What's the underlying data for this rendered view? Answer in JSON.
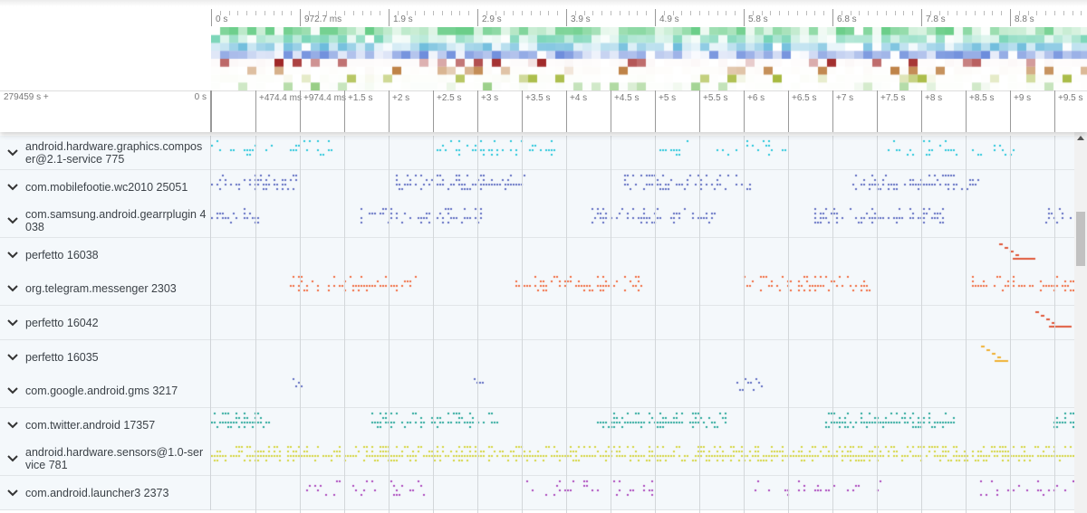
{
  "overview": {
    "ticks": [
      "0 s",
      "972.7 ms",
      "1.9 s",
      "2.9 s",
      "3.9 s",
      "4.9 s",
      "5.8 s",
      "6.8 s",
      "7.8 s",
      "8.8 s"
    ]
  },
  "timeline": {
    "offset_label": "279459 s +",
    "zero_label": "0 s",
    "ticks": [
      "",
      "+474.4 ms",
      "+974.4 ms",
      "+1.5 s",
      "+2 s",
      "+2.5 s",
      "+3 s",
      "+3.5 s",
      "+4 s",
      "+4.5 s",
      "+5 s",
      "+5.5 s",
      "+6 s",
      "+6.5 s",
      "+7 s",
      "+7.5 s",
      "+8 s",
      "+8.5 s",
      "+9 s",
      "+9.5 s"
    ]
  },
  "tracks": [
    {
      "name": "android.hardware.graphics.composer@2.1-service 775",
      "color": "#26c6da"
    },
    {
      "name": "com.mobilefootie.wc2010 25051",
      "color": "#5c6bc0"
    },
    {
      "name": "com.samsung.android.gearrplugin 4038",
      "color": "#5c6bc0"
    },
    {
      "name": "perfetto 16038",
      "color": "#e0583a"
    },
    {
      "name": "org.telegram.messenger 2303",
      "color": "#f06a3c"
    },
    {
      "name": "perfetto 16042",
      "color": "#e0583a"
    },
    {
      "name": "perfetto 16035",
      "color": "#f0b030"
    },
    {
      "name": "com.google.android.gms 3217",
      "color": "#5c6bc0"
    },
    {
      "name": "com.twitter.android 17357",
      "color": "#26a69a"
    },
    {
      "name": "android.hardware.sensors@1.0-service 781",
      "color": "#d4d43a"
    },
    {
      "name": "com.android.launcher3 2373",
      "color": "#ab47bc"
    }
  ]
}
